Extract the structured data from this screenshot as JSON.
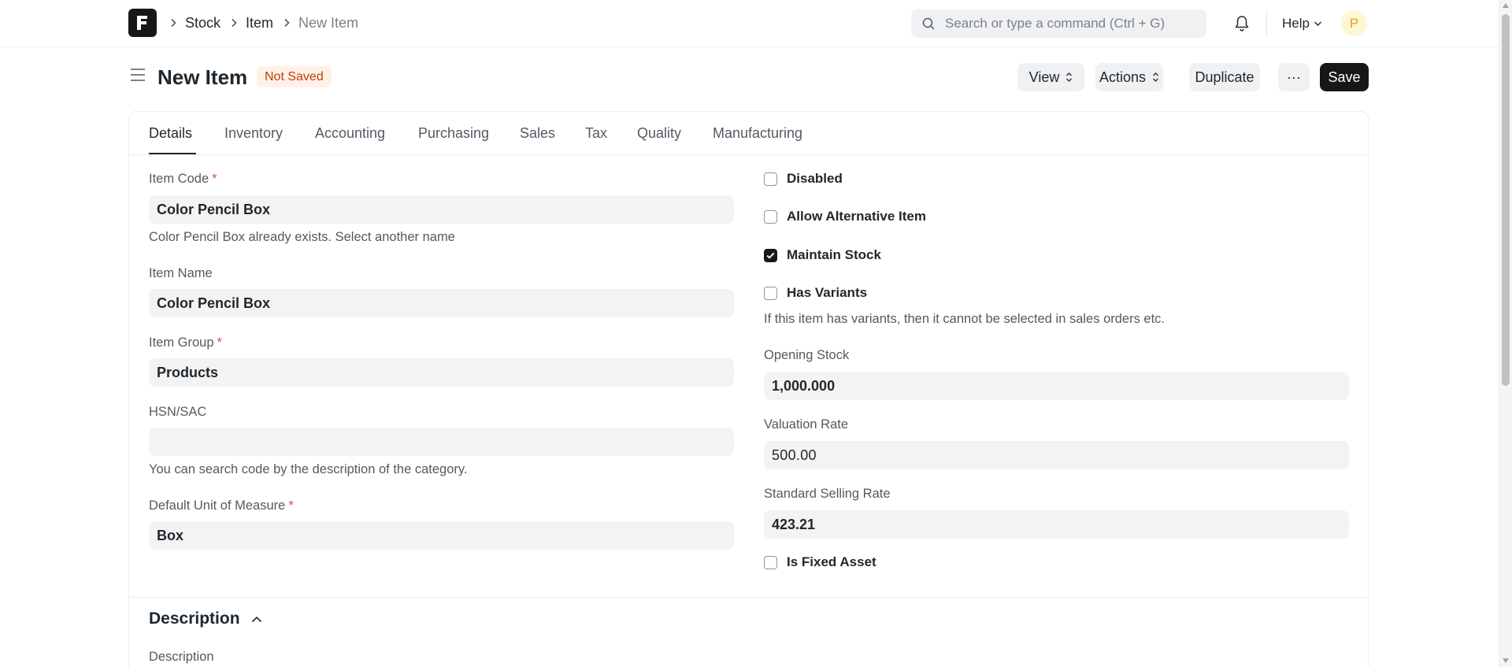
{
  "navbar": {
    "logo_letter": "F",
    "breadcrumbs": [
      "Stock",
      "Item",
      "New Item"
    ],
    "search_placeholder": "Search or type a command (Ctrl + G)",
    "help_label": "Help",
    "avatar_initial": "P"
  },
  "page": {
    "title": "New Item",
    "status": "Not Saved",
    "buttons": {
      "view": "View",
      "actions": "Actions",
      "duplicate": "Duplicate",
      "more": "···",
      "save": "Save"
    }
  },
  "tabs": [
    "Details",
    "Inventory",
    "Accounting",
    "Purchasing",
    "Sales",
    "Tax",
    "Quality",
    "Manufacturing"
  ],
  "left_fields": {
    "item_code": {
      "label": "Item Code",
      "value": "Color Pencil Box",
      "help": "Color Pencil Box already exists. Select another name"
    },
    "item_name": {
      "label": "Item Name",
      "value": "Color Pencil Box"
    },
    "item_group": {
      "label": "Item Group",
      "value": "Products"
    },
    "hsn_sac": {
      "label": "HSN/SAC",
      "value": "",
      "help": "You can search code by the description of the category."
    },
    "uom": {
      "label": "Default Unit of Measure",
      "value": "Box"
    }
  },
  "right_fields": {
    "disabled": {
      "label": "Disabled",
      "checked": false
    },
    "allow_alternative": {
      "label": "Allow Alternative Item",
      "checked": false
    },
    "maintain_stock": {
      "label": "Maintain Stock",
      "checked": true
    },
    "has_variants": {
      "label": "Has Variants",
      "checked": false,
      "help": "If this item has variants, then it cannot be selected in sales orders etc."
    },
    "opening_stock": {
      "label": "Opening Stock",
      "value": "1,000.000"
    },
    "valuation_rate": {
      "label": "Valuation Rate",
      "value": "500.00"
    },
    "standard_selling_rate": {
      "label": "Standard Selling Rate",
      "value": "423.21"
    },
    "is_fixed_asset": {
      "label": "Is Fixed Asset",
      "checked": false
    }
  },
  "description_section": {
    "title": "Description",
    "field_label": "Description"
  },
  "colors": {
    "primary": "#171717",
    "required": "#e24c4c",
    "badge_bg": "#fff1e7",
    "badge_text": "#bd3e0c",
    "field_bg": "#f3f3f3"
  }
}
